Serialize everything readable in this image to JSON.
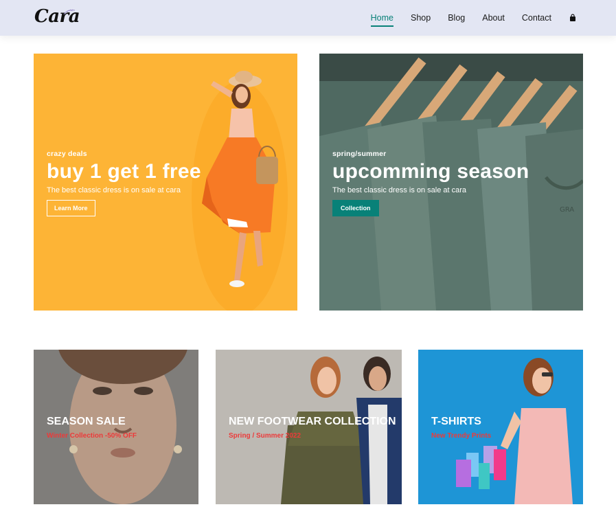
{
  "header": {
    "logo": "Cara",
    "nav": [
      "Home",
      "Shop",
      "Blog",
      "About",
      "Contact"
    ],
    "active_nav": "Home",
    "cart_icon": "shopping-bag-icon"
  },
  "banner_1": {
    "eyebrow": "crazy deals",
    "title": "buy 1 get 1 free",
    "description": "The best classic dress is on sale at cara",
    "button": "Learn More"
  },
  "banner_2": {
    "eyebrow": "spring/summer",
    "title": "upcomming season",
    "description": "The best classic dress is on sale at cara",
    "button": "Collection"
  },
  "small_banners": [
    {
      "title": "SEASON SALE",
      "subtitle": "Winter Collection -50% OFF"
    },
    {
      "title": "NEW FOOTWEAR COLLECTION",
      "subtitle": "Spring / Summer 2022"
    },
    {
      "title": "T-SHIRTS",
      "subtitle": "New Trendy Prints"
    }
  ],
  "colors": {
    "header_bg": "#e3e6f3",
    "accent": "#088178",
    "banner_1_bg": "#fdb436",
    "banner_2_bg": "#5b756c",
    "subtitle_red": "#ec3a3a",
    "tshirt_bg": "#1e95d6"
  }
}
